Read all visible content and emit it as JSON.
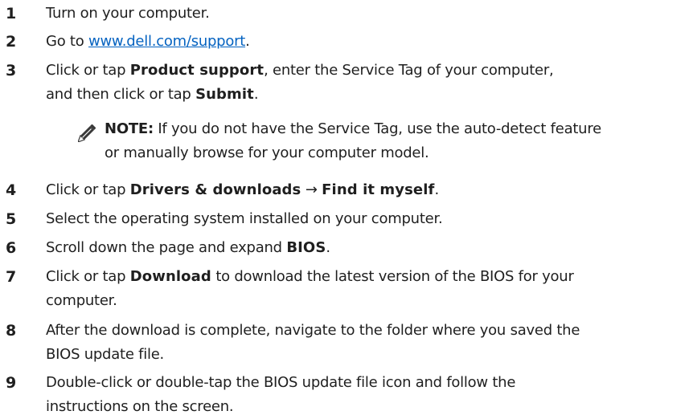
{
  "steps": [
    {
      "num": "1",
      "text": "Turn on your computer."
    },
    {
      "num": "2",
      "pre": "Go to ",
      "link": "www.dell.com/support",
      "post": "."
    },
    {
      "num": "3",
      "a": "Click or tap ",
      "b1": "Product support",
      "c": ", enter the Service Tag of your computer,",
      "d": "and then click or tap ",
      "b2": "Submit",
      "e": "."
    },
    {
      "num": "4",
      "a": "Click or tap ",
      "b1": "Drivers & downloads",
      "arrow": " → ",
      "b2": "Find it myself",
      "e": "."
    },
    {
      "num": "5",
      "text": "Select the operating system installed on your computer."
    },
    {
      "num": "6",
      "a": "Scroll down the page and expand ",
      "b1": "BIOS",
      "e": "."
    },
    {
      "num": "7",
      "a": "Click or tap ",
      "b1": "Download",
      "c": " to download the latest version of the BIOS for your",
      "d": "computer."
    },
    {
      "num": "8",
      "line1": "After the download is complete, navigate to the folder where you saved the",
      "line2": "BIOS update file."
    },
    {
      "num": "9",
      "line1": "Double-click or double-tap the BIOS update file icon and follow the",
      "line2": "instructions on the screen."
    }
  ],
  "note": {
    "label": "NOTE:",
    "line1": " If you do not have the Service Tag, use the auto-detect feature",
    "line2": "or manually browse for your computer model.",
    "icon": "pencil-note-icon"
  }
}
